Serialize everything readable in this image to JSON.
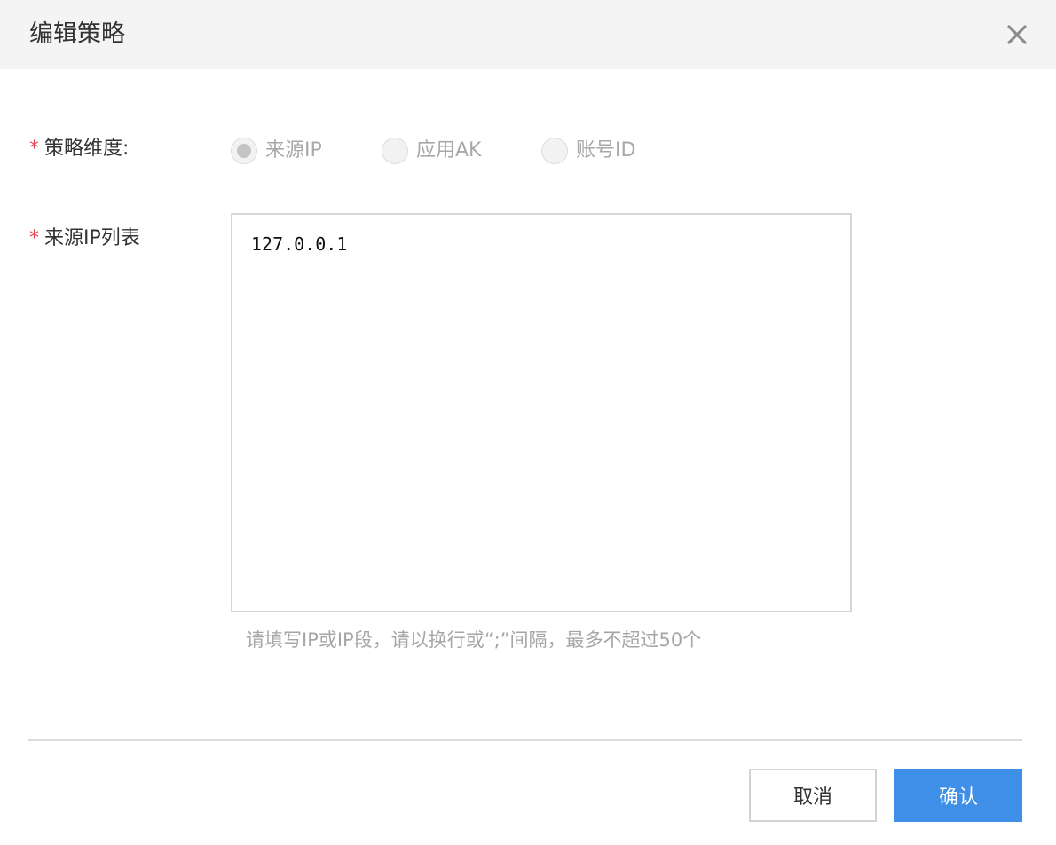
{
  "dialog": {
    "title": "编辑策略",
    "close_icon": "close-icon"
  },
  "form": {
    "dimension": {
      "required_mark": "*",
      "label": "策略维度:",
      "options": [
        {
          "label": "来源IP",
          "selected": true,
          "disabled": true
        },
        {
          "label": "应用AK",
          "selected": false,
          "disabled": true
        },
        {
          "label": "账号ID",
          "selected": false,
          "disabled": true
        }
      ]
    },
    "ip_list": {
      "required_mark": "*",
      "label": "来源IP列表",
      "value": "127.0.0.1",
      "hint": "请填写IP或IP段，请以换行或“;”间隔，最多不超过50个"
    }
  },
  "footer": {
    "cancel_label": "取消",
    "confirm_label": "确认"
  },
  "colors": {
    "primary": "#3f8fe8",
    "required": "#e64552",
    "header_bg": "#f4f4f4",
    "disabled_text": "#a8a8a8"
  }
}
